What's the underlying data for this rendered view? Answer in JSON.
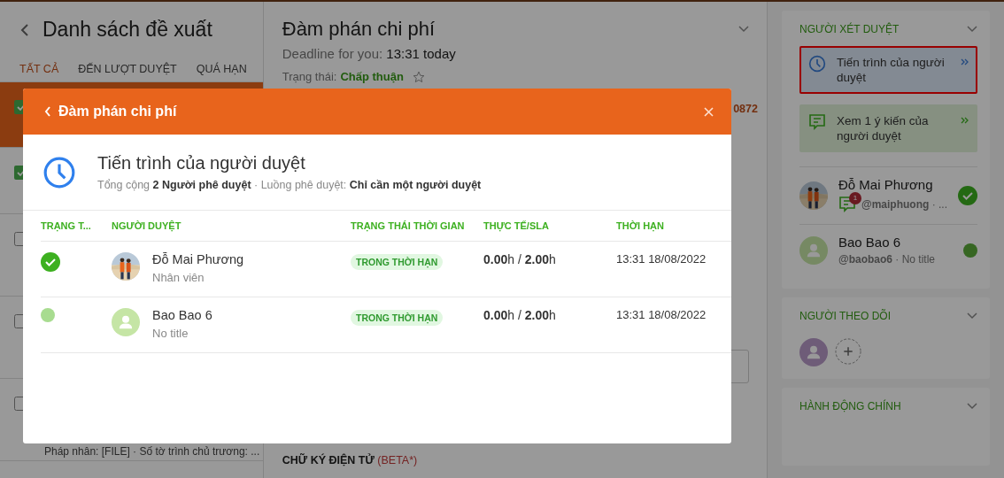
{
  "left_panel": {
    "title": "Danh sách đề xuất",
    "tabs": [
      {
        "label": "TẤT CẢ",
        "selected": true
      },
      {
        "label": "ĐẾN LƯỢT DUYỆT",
        "selected": false
      },
      {
        "label": "QUÁ HẠN",
        "selected": false
      }
    ],
    "rows": [
      {
        "selected": true,
        "checked": true
      },
      {
        "selected": false,
        "checked": true
      },
      {
        "selected": false,
        "checked": false
      },
      {
        "selected": false,
        "checked": false
      },
      {
        "selected": false,
        "checked": false,
        "snippet": "Pháp nhân: [FILE] · Số tờ trình chủ trương: ..."
      }
    ]
  },
  "main": {
    "title": "Đàm phán chi phí",
    "deadline_label": "Deadline for you:",
    "deadline_value": "13:31 today",
    "status_label": "Trạng thái:",
    "status_value": "Chấp thuận",
    "starred": false,
    "code": "0872",
    "signature_label": "CHỮ KÝ ĐIỆN TỬ",
    "signature_tag": "(BETA*)"
  },
  "right_panel": {
    "approvers": {
      "title": "NGƯỜI XÉT DUYỆT",
      "actions": [
        {
          "kind": "progress",
          "label": "Tiến trình của người duyệt",
          "highlighted": true
        },
        {
          "kind": "comments",
          "label": "Xem 1 ý kiến của người duyệt",
          "highlighted": false
        }
      ],
      "people": [
        {
          "name": "Đỗ Mai Phương",
          "photo": true,
          "comment_count": "1",
          "handle": "**@maiphuong** · ...",
          "approved": true
        },
        {
          "name": "Bao Bao 6",
          "photo": false,
          "handle": "**@baobao6** · No title",
          "approved": false
        }
      ]
    },
    "followers": {
      "title": "NGƯỜI THEO DÕI"
    },
    "main_actions": {
      "title": "HÀNH ĐỘNG CHÍNH"
    }
  },
  "modal": {
    "header": "Đàm phán chi phí",
    "title": "Tiến trình của người duyệt",
    "summary": "Tổng cộng **2 Người phê duyệt** · Luồng phê duyệt: **Chỉ cần một người duyệt**",
    "columns": [
      "TRẠNG T...",
      "NGƯỜI DUYỆT",
      "TRẠNG THÁI THỜI GIAN",
      "THỰC TẾ/SLA",
      "THỜI HẠN"
    ],
    "rows": [
      {
        "approved": true,
        "photo": true,
        "name": "Đỗ Mai Phương",
        "role": "Nhân viên",
        "time_status": "TRONG THỜI HẠN",
        "actual_sla": "**0.00**h / **2.00**h",
        "deadline": "13:31 18/08/2022"
      },
      {
        "approved": false,
        "photo": false,
        "name": "Bao Bao 6",
        "role": "No title",
        "time_status": "TRONG THỜI HẠN",
        "actual_sla": "**0.00**h / **2.00**h",
        "deadline": "13:31 18/08/2022"
      }
    ]
  }
}
